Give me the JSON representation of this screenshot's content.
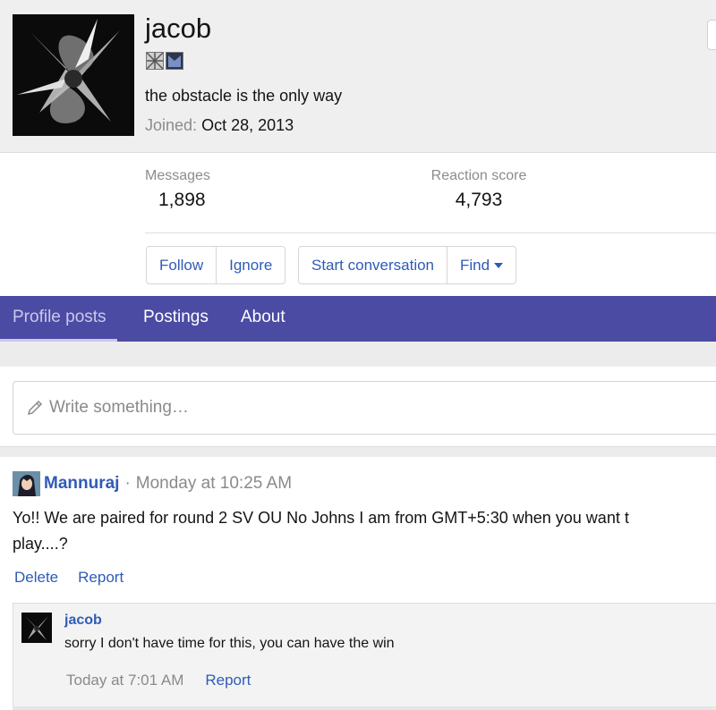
{
  "profile": {
    "username": "jacob",
    "status": "the obstacle is the only way",
    "joined_label": "Joined:",
    "joined_date": "Oct 28, 2013",
    "badges": [
      "trophy-badge-icon",
      "flag-badge-icon"
    ]
  },
  "stats": {
    "messages_label": "Messages",
    "messages_value": "1,898",
    "reaction_label": "Reaction score",
    "reaction_value": "4,793"
  },
  "actions": {
    "follow": "Follow",
    "ignore": "Ignore",
    "start_conversation": "Start conversation",
    "find": "Find"
  },
  "tabs": {
    "profile_posts": "Profile posts",
    "postings": "Postings",
    "about": "About"
  },
  "composer": {
    "placeholder": "Write something…"
  },
  "post": {
    "author": "Mannuraj",
    "separator": "·",
    "time": "Monday at 10:25 AM",
    "line1": "Yo!! We are paired for round 2 SV OU No Johns I am from GMT+5:30 when you want t",
    "line2": "play....?",
    "delete": "Delete",
    "report": "Report"
  },
  "reply": {
    "author": "jacob",
    "text": "sorry I don't have time for this, you can have the win",
    "time": "Today at 7:01 AM",
    "report": "Report"
  },
  "colors": {
    "accent": "#2f5bb7",
    "tab_bar": "#4c4ba3",
    "header_bg": "#efefef"
  }
}
